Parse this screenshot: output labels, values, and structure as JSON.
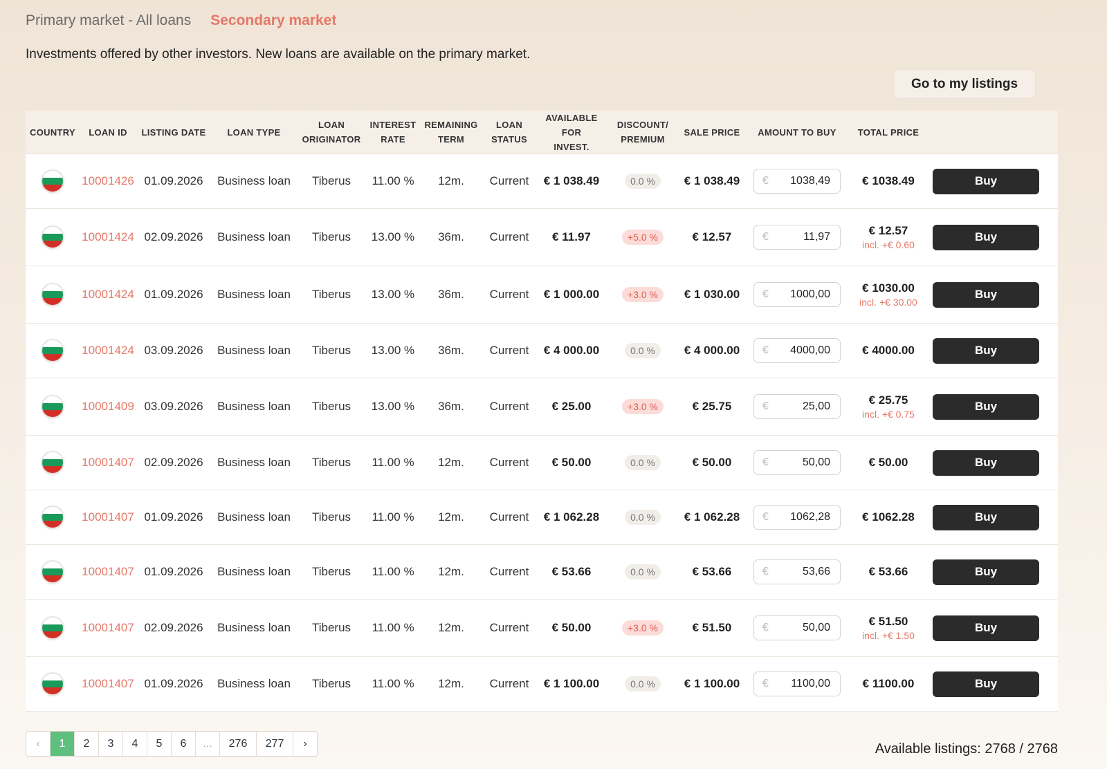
{
  "tabs": [
    {
      "label": "Primary market - All loans",
      "active": false
    },
    {
      "label": "Secondary market",
      "active": true
    }
  ],
  "subtitle": "Investments offered by other investors. New loans are available on the primary market.",
  "my_listings_button": "Go to my listings",
  "columns": {
    "country": "COUNTRY",
    "loan_id": "LOAN ID",
    "listing_date": "LISTING DATE",
    "loan_type": "LOAN TYPE",
    "originator_1": "LOAN",
    "originator_2": "ORIGINATOR",
    "rate_1": "INTEREST",
    "rate_2": "RATE",
    "term_1": "REMAINING",
    "term_2": "TERM",
    "status_1": "LOAN",
    "status_2": "STATUS",
    "avail_1": "AVAILABLE FOR",
    "avail_2": "INVEST.",
    "disc_1": "DISCOUNT/",
    "disc_2": "PREMIUM",
    "sale_price": "SALE PRICE",
    "amount": "AMOUNT TO BUY",
    "total": "TOTAL PRICE"
  },
  "currency_symbol": "€",
  "buy_label": "Buy",
  "rows": [
    {
      "id": "10001426",
      "date": "01.09.2026",
      "type": "Business loan",
      "orig": "Tiberus",
      "rate": "11.00 %",
      "term": "12m.",
      "status": "Current",
      "avail": "€ 1 038.49",
      "disc": "0.0 %",
      "disc_pos": false,
      "sale": "€ 1 038.49",
      "amount": "1038,49",
      "total": "€ 1038.49",
      "incl": ""
    },
    {
      "id": "10001424",
      "date": "02.09.2026",
      "type": "Business loan",
      "orig": "Tiberus",
      "rate": "13.00 %",
      "term": "36m.",
      "status": "Current",
      "avail": "€ 11.97",
      "disc": "+5.0 %",
      "disc_pos": true,
      "sale": "€ 12.57",
      "amount": "11,97",
      "total": "€ 12.57",
      "incl": "incl. +€ 0.60"
    },
    {
      "id": "10001424",
      "date": "01.09.2026",
      "type": "Business loan",
      "orig": "Tiberus",
      "rate": "13.00 %",
      "term": "36m.",
      "status": "Current",
      "avail": "€ 1 000.00",
      "disc": "+3.0 %",
      "disc_pos": true,
      "sale": "€ 1 030.00",
      "amount": "1000,00",
      "total": "€ 1030.00",
      "incl": "incl. +€ 30.00"
    },
    {
      "id": "10001424",
      "date": "03.09.2026",
      "type": "Business loan",
      "orig": "Tiberus",
      "rate": "13.00 %",
      "term": "36m.",
      "status": "Current",
      "avail": "€ 4 000.00",
      "disc": "0.0 %",
      "disc_pos": false,
      "sale": "€ 4 000.00",
      "amount": "4000,00",
      "total": "€ 4000.00",
      "incl": ""
    },
    {
      "id": "10001409",
      "date": "03.09.2026",
      "type": "Business loan",
      "orig": "Tiberus",
      "rate": "13.00 %",
      "term": "36m.",
      "status": "Current",
      "avail": "€ 25.00",
      "disc": "+3.0 %",
      "disc_pos": true,
      "sale": "€ 25.75",
      "amount": "25,00",
      "total": "€ 25.75",
      "incl": "incl. +€ 0.75"
    },
    {
      "id": "10001407",
      "date": "02.09.2026",
      "type": "Business loan",
      "orig": "Tiberus",
      "rate": "11.00 %",
      "term": "12m.",
      "status": "Current",
      "avail": "€ 50.00",
      "disc": "0.0 %",
      "disc_pos": false,
      "sale": "€ 50.00",
      "amount": "50,00",
      "total": "€ 50.00",
      "incl": ""
    },
    {
      "id": "10001407",
      "date": "01.09.2026",
      "type": "Business loan",
      "orig": "Tiberus",
      "rate": "11.00 %",
      "term": "12m.",
      "status": "Current",
      "avail": "€ 1 062.28",
      "disc": "0.0 %",
      "disc_pos": false,
      "sale": "€ 1 062.28",
      "amount": "1062,28",
      "total": "€ 1062.28",
      "incl": ""
    },
    {
      "id": "10001407",
      "date": "01.09.2026",
      "type": "Business loan",
      "orig": "Tiberus",
      "rate": "11.00 %",
      "term": "12m.",
      "status": "Current",
      "avail": "€ 53.66",
      "disc": "0.0 %",
      "disc_pos": false,
      "sale": "€ 53.66",
      "amount": "53,66",
      "total": "€ 53.66",
      "incl": ""
    },
    {
      "id": "10001407",
      "date": "02.09.2026",
      "type": "Business loan",
      "orig": "Tiberus",
      "rate": "11.00 %",
      "term": "12m.",
      "status": "Current",
      "avail": "€ 50.00",
      "disc": "+3.0 %",
      "disc_pos": true,
      "sale": "€ 51.50",
      "amount": "50,00",
      "total": "€ 51.50",
      "incl": "incl. +€ 1.50"
    },
    {
      "id": "10001407",
      "date": "01.09.2026",
      "type": "Business loan",
      "orig": "Tiberus",
      "rate": "11.00 %",
      "term": "12m.",
      "status": "Current",
      "avail": "€ 1 100.00",
      "disc": "0.0 %",
      "disc_pos": false,
      "sale": "€ 1 100.00",
      "amount": "1100,00",
      "total": "€ 1100.00",
      "incl": ""
    }
  ],
  "pagination": {
    "prev": "‹",
    "pages": [
      "1",
      "2",
      "3",
      "4",
      "5",
      "6",
      "...",
      "276",
      "277"
    ],
    "active": "1",
    "next": "›"
  },
  "available_listings": "Available listings: 2768 / 2768",
  "colors": {
    "accent": "#e47869",
    "buy_button": "#2b2b2b",
    "active_page": "#5fbf7f",
    "flag": [
      "#ffffff",
      "#1a9a5a",
      "#d22f27"
    ]
  }
}
